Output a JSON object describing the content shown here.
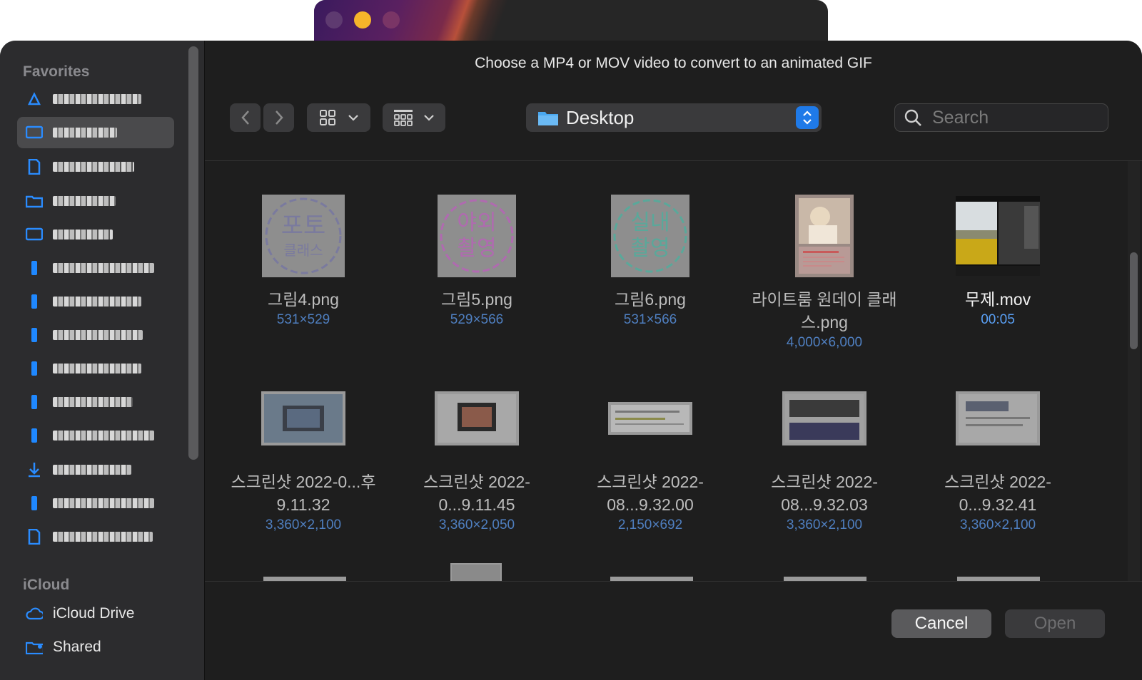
{
  "background_window": {
    "traffic_colors": [
      "#5e3a70",
      "#f5b52a",
      "#7a3566"
    ]
  },
  "dialog": {
    "title": "Choose a MP4 or MOV video to convert to an animated GIF",
    "location": "Desktop",
    "search_placeholder": "Search",
    "cancel_label": "Cancel",
    "open_label": "Open"
  },
  "sidebar": {
    "favorites_title": "Favorites",
    "icloud_title": "iCloud",
    "icloud_items": [
      {
        "label": "iCloud Drive",
        "icon": "cloud-icon"
      },
      {
        "label": "Shared",
        "icon": "shared-folder-icon"
      }
    ]
  },
  "files": [
    {
      "name": "그림4.png",
      "meta": "531×529"
    },
    {
      "name": "그림5.png",
      "meta": "529×566"
    },
    {
      "name": "그림6.png",
      "meta": "531×566"
    },
    {
      "name": "라이트룸 원데이 클래스.png",
      "meta": "4,000×6,000"
    },
    {
      "name": "무제.mov",
      "meta": "00:05"
    },
    {
      "name": "스크린샷 2022-0...후 9.11.32",
      "meta": "3,360×2,100"
    },
    {
      "name": "스크린샷 2022-0...9.11.45",
      "meta": "3,360×2,050"
    },
    {
      "name": "스크린샷 2022-08...9.32.00",
      "meta": "2,150×692"
    },
    {
      "name": "스크린샷 2022-08...9.32.03",
      "meta": "3,360×2,100"
    },
    {
      "name": "스크린샷 2022-0...9.32.41",
      "meta": "3,360×2,100"
    }
  ],
  "stamps": [
    {
      "line1": "포토",
      "line2": "클래스",
      "color": "#7a7a9e"
    },
    {
      "line1": "야외",
      "line2": "촬영",
      "color": "#b06ab0"
    },
    {
      "line1": "실내",
      "line2": "촬영",
      "color": "#5aa89a"
    }
  ]
}
